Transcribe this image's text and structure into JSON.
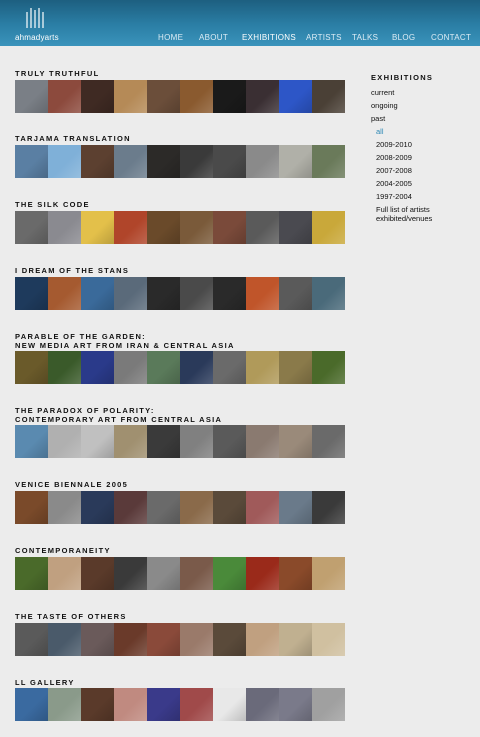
{
  "header": {
    "logo_text": "ahmadyarts",
    "nav": [
      "HOME",
      "ABOUT",
      "EXHIBITIONS",
      "ARTISTS",
      "TALKS",
      "BLOG",
      "CONTACT"
    ],
    "active": "EXHIBITIONS"
  },
  "sections": [
    {
      "title": "TRULY TRUTHFUL",
      "thumbs": [
        "#7a7f86",
        "#8c4a3d",
        "#3f2a23",
        "#b58a57",
        "#6b4e3a",
        "#8a5a2f",
        "#1a1a1a",
        "#3a2f33",
        "#2d56c7",
        "#4a4036"
      ]
    },
    {
      "title": "TARJAMA TRANSLATION",
      "thumbs": [
        "#5a7fa3",
        "#7fb0d8",
        "#5c4030",
        "#6b7c8c",
        "#2c2a28",
        "#3a3a3a",
        "#4a4a4a",
        "#8a8a8a",
        "#b0b0a8",
        "#6a7a5a"
      ]
    },
    {
      "title": "THE SILK CODE",
      "thumbs": [
        "#6a6a6a",
        "#8a8a90",
        "#e3c04a",
        "#b0452a",
        "#6a4a2a",
        "#7a5a3a",
        "#7a4a3a",
        "#5a5a5a",
        "#4a4a50",
        "#c9a83a"
      ]
    },
    {
      "title": "I DREAM OF THE STANS",
      "thumbs": [
        "#1e3a5c",
        "#a55a30",
        "#3a6a9a",
        "#5a6a7a",
        "#2a2a2a",
        "#4a4a4a",
        "#2a2a2a",
        "#c0552a",
        "#5a5a5a",
        "#4a6a7a"
      ]
    },
    {
      "title_lines": [
        "PARABLE OF THE GARDEN:",
        "NEW MEDIA ART FROM IRAN & CENTRAL ASIA"
      ],
      "thumbs": [
        "#6a5a2a",
        "#3a5a2a",
        "#2a3a8a",
        "#7a7a7a",
        "#5a7a5a",
        "#2a3a5a",
        "#6a6a6a",
        "#b09a5a",
        "#8a7a4a",
        "#4a6a2a"
      ]
    },
    {
      "title_lines": [
        "THE PARADOX OF POLARITY:",
        "CONTEMPORARY ART FROM CENTRAL ASIA"
      ],
      "thumbs": [
        "#5a8ab0",
        "#b0b0b0",
        "#c0c0c0",
        "#a09070",
        "#3a3a3a",
        "#808080",
        "#5a5a5a",
        "#8a7a70",
        "#9a8a7a",
        "#6a6a6a"
      ]
    },
    {
      "title": "VENICE BIENNALE 2005",
      "thumbs": [
        "#7a4a2a",
        "#8a8a8a",
        "#2a3a5a",
        "#5a3a3a",
        "#6a6a6a",
        "#8a6a4a",
        "#5a4a3a",
        "#a05a5a",
        "#6a7a8a",
        "#3a3a3a"
      ]
    },
    {
      "title": "CONTEMPORANEITY",
      "thumbs": [
        "#4a6a2a",
        "#c0a080",
        "#5a3a2a",
        "#3a3a3a",
        "#8a8a8a",
        "#7a5a4a",
        "#4a8a3a",
        "#9a2a1a",
        "#8a4a2a",
        "#c0a070"
      ]
    },
    {
      "title": "THE TASTE OF OTHERS",
      "thumbs": [
        "#5a5a5a",
        "#4a5a6a",
        "#6a5a5a",
        "#6a3a2a",
        "#8a4a3a",
        "#9a7a6a",
        "#5a4a3a",
        "#c0a080",
        "#c0b090",
        "#d0c0a0"
      ]
    },
    {
      "title": "LL GALLERY",
      "thumbs": [
        "#3a6aa0",
        "#8a9a8a",
        "#5a3a2a",
        "#c08a80",
        "#3a3a8a",
        "#a04a4a",
        "#e8e8e8",
        "#6a6a7a",
        "#7a7a8a",
        "#a0a0a0"
      ]
    }
  ],
  "sidebar": {
    "title": "EXHIBITIONS",
    "items": [
      "current",
      "ongoing",
      "past"
    ],
    "past_subitems": [
      "all",
      "2009-2010",
      "2008-2009",
      "2007-2008",
      "2004-2005",
      "1997-2004"
    ],
    "footer_lines": [
      "Full list of artists",
      "exhibited/venues"
    ],
    "accent": "#2d88b5"
  }
}
